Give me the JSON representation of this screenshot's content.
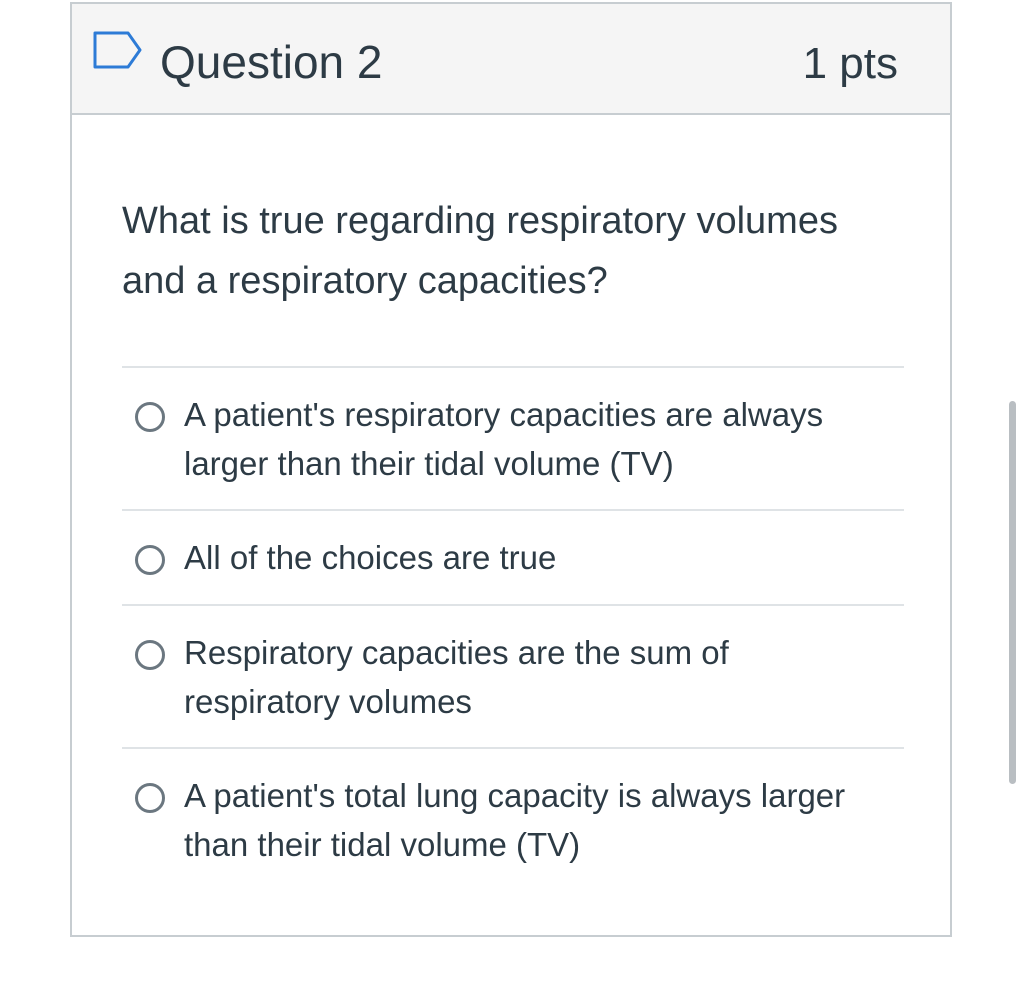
{
  "question": {
    "title": "Question 2",
    "points": "1 pts",
    "flag_icon": "flag-outline-icon",
    "text": "What is true regarding respiratory volumes and a respiratory capacities?"
  },
  "answers": [
    {
      "label": "A patient's respiratory capacities are always larger than their tidal volume (TV)",
      "selected": false
    },
    {
      "label": "All of the choices are true",
      "selected": false
    },
    {
      "label": "Respiratory capacities are the sum of respiratory volumes",
      "selected": false
    },
    {
      "label": "A patient's total lung capacity is always larger than their tidal volume (TV)",
      "selected": false
    }
  ],
  "colors": {
    "header_bg": "#f5f5f5",
    "border": "#c7cdd1",
    "divider": "#dfe3e6",
    "text": "#2d3b45",
    "flag_stroke": "#2d7bd6"
  }
}
